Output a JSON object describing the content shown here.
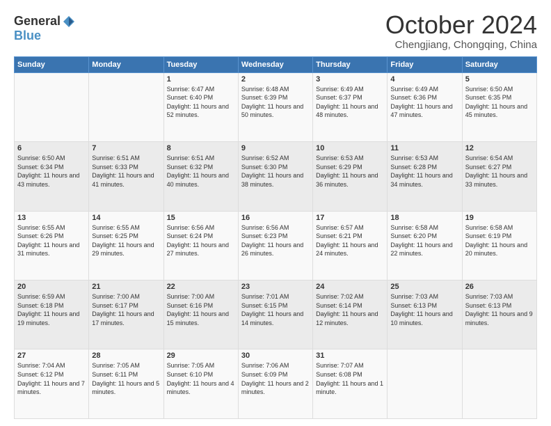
{
  "logo": {
    "general": "General",
    "blue": "Blue"
  },
  "title": "October 2024",
  "location": "Chengjiang, Chongqing, China",
  "days_of_week": [
    "Sunday",
    "Monday",
    "Tuesday",
    "Wednesday",
    "Thursday",
    "Friday",
    "Saturday"
  ],
  "weeks": [
    [
      {
        "day": "",
        "info": ""
      },
      {
        "day": "",
        "info": ""
      },
      {
        "day": "1",
        "sunrise": "Sunrise: 6:47 AM",
        "sunset": "Sunset: 6:40 PM",
        "daylight": "Daylight: 11 hours and 52 minutes."
      },
      {
        "day": "2",
        "sunrise": "Sunrise: 6:48 AM",
        "sunset": "Sunset: 6:39 PM",
        "daylight": "Daylight: 11 hours and 50 minutes."
      },
      {
        "day": "3",
        "sunrise": "Sunrise: 6:49 AM",
        "sunset": "Sunset: 6:37 PM",
        "daylight": "Daylight: 11 hours and 48 minutes."
      },
      {
        "day": "4",
        "sunrise": "Sunrise: 6:49 AM",
        "sunset": "Sunset: 6:36 PM",
        "daylight": "Daylight: 11 hours and 47 minutes."
      },
      {
        "day": "5",
        "sunrise": "Sunrise: 6:50 AM",
        "sunset": "Sunset: 6:35 PM",
        "daylight": "Daylight: 11 hours and 45 minutes."
      }
    ],
    [
      {
        "day": "6",
        "sunrise": "Sunrise: 6:50 AM",
        "sunset": "Sunset: 6:34 PM",
        "daylight": "Daylight: 11 hours and 43 minutes."
      },
      {
        "day": "7",
        "sunrise": "Sunrise: 6:51 AM",
        "sunset": "Sunset: 6:33 PM",
        "daylight": "Daylight: 11 hours and 41 minutes."
      },
      {
        "day": "8",
        "sunrise": "Sunrise: 6:51 AM",
        "sunset": "Sunset: 6:32 PM",
        "daylight": "Daylight: 11 hours and 40 minutes."
      },
      {
        "day": "9",
        "sunrise": "Sunrise: 6:52 AM",
        "sunset": "Sunset: 6:30 PM",
        "daylight": "Daylight: 11 hours and 38 minutes."
      },
      {
        "day": "10",
        "sunrise": "Sunrise: 6:53 AM",
        "sunset": "Sunset: 6:29 PM",
        "daylight": "Daylight: 11 hours and 36 minutes."
      },
      {
        "day": "11",
        "sunrise": "Sunrise: 6:53 AM",
        "sunset": "Sunset: 6:28 PM",
        "daylight": "Daylight: 11 hours and 34 minutes."
      },
      {
        "day": "12",
        "sunrise": "Sunrise: 6:54 AM",
        "sunset": "Sunset: 6:27 PM",
        "daylight": "Daylight: 11 hours and 33 minutes."
      }
    ],
    [
      {
        "day": "13",
        "sunrise": "Sunrise: 6:55 AM",
        "sunset": "Sunset: 6:26 PM",
        "daylight": "Daylight: 11 hours and 31 minutes."
      },
      {
        "day": "14",
        "sunrise": "Sunrise: 6:55 AM",
        "sunset": "Sunset: 6:25 PM",
        "daylight": "Daylight: 11 hours and 29 minutes."
      },
      {
        "day": "15",
        "sunrise": "Sunrise: 6:56 AM",
        "sunset": "Sunset: 6:24 PM",
        "daylight": "Daylight: 11 hours and 27 minutes."
      },
      {
        "day": "16",
        "sunrise": "Sunrise: 6:56 AM",
        "sunset": "Sunset: 6:23 PM",
        "daylight": "Daylight: 11 hours and 26 minutes."
      },
      {
        "day": "17",
        "sunrise": "Sunrise: 6:57 AM",
        "sunset": "Sunset: 6:21 PM",
        "daylight": "Daylight: 11 hours and 24 minutes."
      },
      {
        "day": "18",
        "sunrise": "Sunrise: 6:58 AM",
        "sunset": "Sunset: 6:20 PM",
        "daylight": "Daylight: 11 hours and 22 minutes."
      },
      {
        "day": "19",
        "sunrise": "Sunrise: 6:58 AM",
        "sunset": "Sunset: 6:19 PM",
        "daylight": "Daylight: 11 hours and 20 minutes."
      }
    ],
    [
      {
        "day": "20",
        "sunrise": "Sunrise: 6:59 AM",
        "sunset": "Sunset: 6:18 PM",
        "daylight": "Daylight: 11 hours and 19 minutes."
      },
      {
        "day": "21",
        "sunrise": "Sunrise: 7:00 AM",
        "sunset": "Sunset: 6:17 PM",
        "daylight": "Daylight: 11 hours and 17 minutes."
      },
      {
        "day": "22",
        "sunrise": "Sunrise: 7:00 AM",
        "sunset": "Sunset: 6:16 PM",
        "daylight": "Daylight: 11 hours and 15 minutes."
      },
      {
        "day": "23",
        "sunrise": "Sunrise: 7:01 AM",
        "sunset": "Sunset: 6:15 PM",
        "daylight": "Daylight: 11 hours and 14 minutes."
      },
      {
        "day": "24",
        "sunrise": "Sunrise: 7:02 AM",
        "sunset": "Sunset: 6:14 PM",
        "daylight": "Daylight: 11 hours and 12 minutes."
      },
      {
        "day": "25",
        "sunrise": "Sunrise: 7:03 AM",
        "sunset": "Sunset: 6:13 PM",
        "daylight": "Daylight: 11 hours and 10 minutes."
      },
      {
        "day": "26",
        "sunrise": "Sunrise: 7:03 AM",
        "sunset": "Sunset: 6:13 PM",
        "daylight": "Daylight: 11 hours and 9 minutes."
      }
    ],
    [
      {
        "day": "27",
        "sunrise": "Sunrise: 7:04 AM",
        "sunset": "Sunset: 6:12 PM",
        "daylight": "Daylight: 11 hours and 7 minutes."
      },
      {
        "day": "28",
        "sunrise": "Sunrise: 7:05 AM",
        "sunset": "Sunset: 6:11 PM",
        "daylight": "Daylight: 11 hours and 5 minutes."
      },
      {
        "day": "29",
        "sunrise": "Sunrise: 7:05 AM",
        "sunset": "Sunset: 6:10 PM",
        "daylight": "Daylight: 11 hours and 4 minutes."
      },
      {
        "day": "30",
        "sunrise": "Sunrise: 7:06 AM",
        "sunset": "Sunset: 6:09 PM",
        "daylight": "Daylight: 11 hours and 2 minutes."
      },
      {
        "day": "31",
        "sunrise": "Sunrise: 7:07 AM",
        "sunset": "Sunset: 6:08 PM",
        "daylight": "Daylight: 11 hours and 1 minute."
      },
      {
        "day": "",
        "info": ""
      },
      {
        "day": "",
        "info": ""
      }
    ]
  ]
}
